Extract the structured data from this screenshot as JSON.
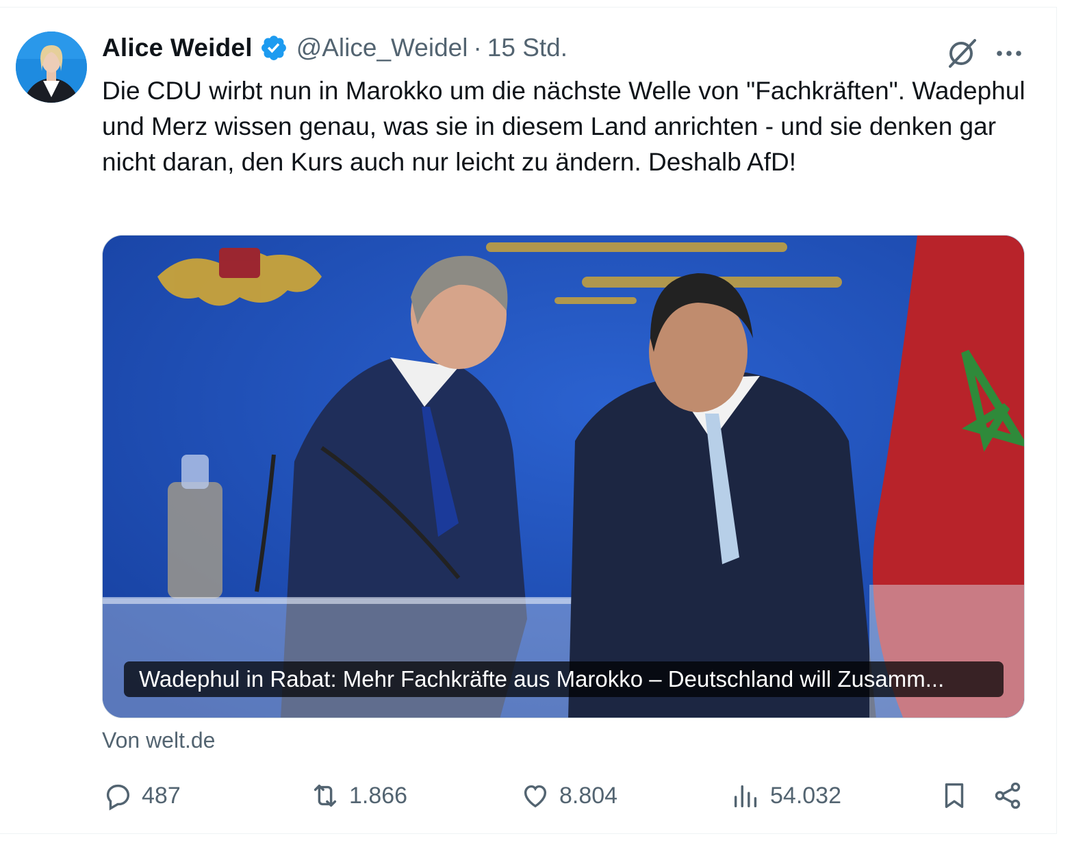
{
  "author": {
    "display_name": "Alice Weidel",
    "handle": "@Alice_Weidel",
    "separator": "·",
    "time": "15 Std.",
    "verified": true,
    "verified_color": "#1d9bf0"
  },
  "tweet": {
    "text": "Die CDU wirbt nun in Marokko um die nächste Welle von \"Fachkräften\". Wadephul und Merz wissen genau, was sie in diesem Land anrichten - und sie denken gar nicht daran, den Kurs auch nur leicht zu ändern. Deshalb AfD!"
  },
  "card": {
    "caption": "Wadephul in Rabat: Mehr Fachkräfte aus Marokko – Deutschland will Zusamm...",
    "source": "Von welt.de"
  },
  "actions": {
    "replies": "487",
    "reposts": "1.866",
    "likes": "8.804",
    "views": "54.032"
  },
  "icons": {
    "grok": "grok-icon",
    "more": "more-icon",
    "reply": "reply-icon",
    "repost": "repost-icon",
    "like": "like-icon",
    "views": "views-icon",
    "bookmark": "bookmark-icon",
    "share": "share-icon"
  },
  "colors": {
    "text_primary": "#0f1419",
    "text_secondary": "#536471",
    "border": "#cfd9de"
  }
}
